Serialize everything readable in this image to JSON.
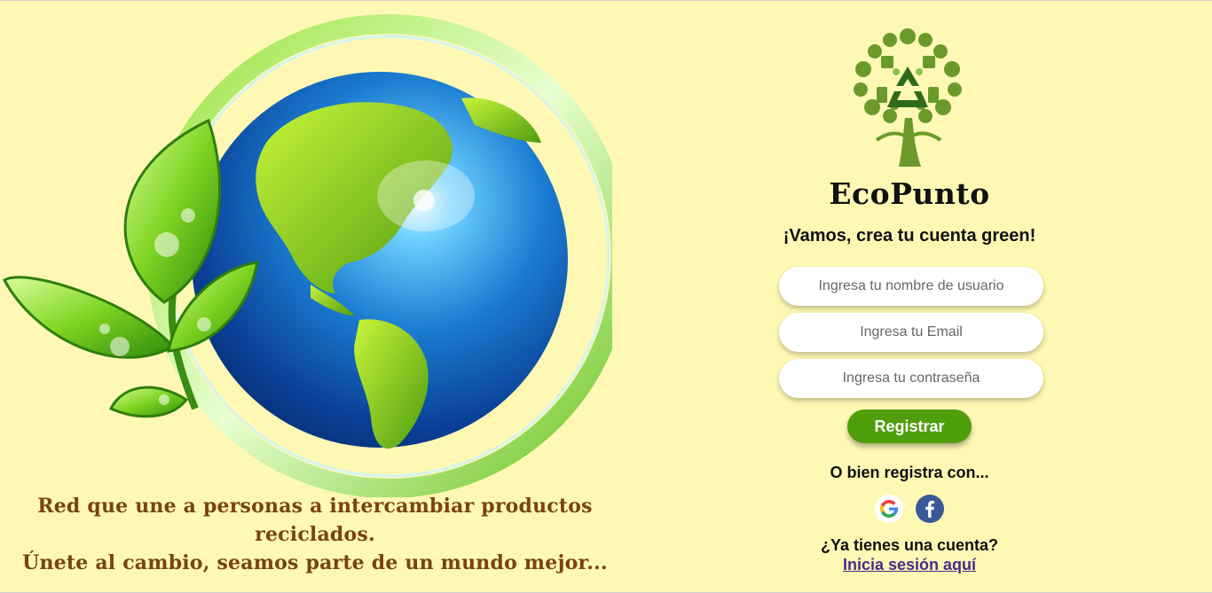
{
  "hero": {
    "tagline_line1": "Red que une a personas a intercambiar productos",
    "tagline_line2": "reciclados.",
    "tagline_line3": "Únete al cambio, seamos parte de un mundo mejor..."
  },
  "brand": {
    "name": "EcoPunto",
    "subtitle": "¡Vamos, crea tu cuenta green!",
    "logo_icon": "eco-tree-icon"
  },
  "form": {
    "username_placeholder": "Ingresa tu nombre de usuario",
    "email_placeholder": "Ingresa tu Email",
    "password_placeholder": "Ingresa tu contraseña",
    "submit_label": "Registrar"
  },
  "social": {
    "prompt": "O bien registra con...",
    "google_icon": "google-icon",
    "facebook_icon": "facebook-icon"
  },
  "login": {
    "question": "¿Ya tienes una cuenta?",
    "link_label": "Inicia sesión aquí"
  },
  "colors": {
    "background": "#fff8b5",
    "accent_green": "#4f9e0c",
    "tagline_brown": "#7a4212",
    "link_purple": "#4a2a8a"
  }
}
